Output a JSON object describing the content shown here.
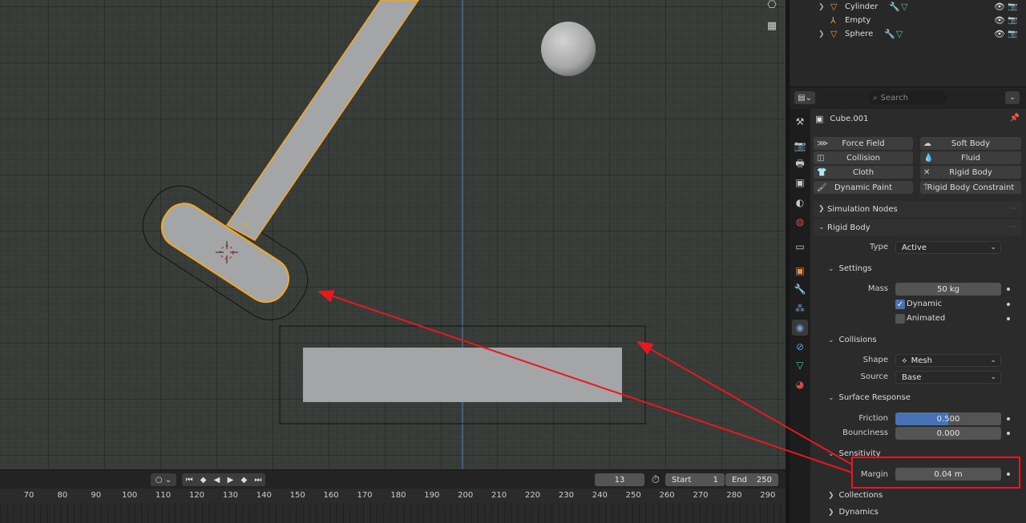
{
  "outliner": {
    "items": [
      {
        "name": "Cylinder",
        "expandable": true
      },
      {
        "name": "Empty",
        "expandable": false
      },
      {
        "name": "Sphere",
        "expandable": true
      }
    ]
  },
  "properties_header": {
    "search_placeholder": "Search"
  },
  "object": {
    "name": "Cube.001"
  },
  "physics_buttons": {
    "force_field": "Force Field",
    "soft_body": "Soft Body",
    "collision": "Collision",
    "fluid": "Fluid",
    "cloth": "Cloth",
    "rigid_body": "Rigid Body",
    "dynamic_paint": "Dynamic Paint",
    "rigid_body_constraint": "Rigid Body Constraint"
  },
  "panels": {
    "simulation_nodes": "Simulation Nodes",
    "rigid_body": "Rigid Body",
    "settings": "Settings",
    "collisions": "Collisions",
    "surface_response": "Surface Response",
    "sensitivity": "Sensitivity",
    "collections": "Collections",
    "dynamics": "Dynamics"
  },
  "rigid_body": {
    "type_label": "Type",
    "type_value": "Active",
    "mass_label": "Mass",
    "mass_value": "50 kg",
    "dynamic_label": "Dynamic",
    "dynamic_checked": true,
    "animated_label": "Animated",
    "animated_checked": false,
    "shape_label": "Shape",
    "shape_value": "Mesh",
    "source_label": "Source",
    "source_value": "Base",
    "friction_label": "Friction",
    "friction_value": "0.500",
    "friction_fraction": 0.5,
    "bounciness_label": "Bounciness",
    "bounciness_value": "0.000",
    "margin_label": "Margin",
    "margin_value": "0.04 m"
  },
  "timeline": {
    "current_frame": "13",
    "start_label": "Start",
    "start_value": "1",
    "end_label": "End",
    "end_value": "250",
    "ruler": [
      "70",
      "80",
      "90",
      "100",
      "110",
      "120",
      "130",
      "140",
      "150",
      "160",
      "170",
      "180",
      "190",
      "200",
      "210",
      "220",
      "230",
      "240",
      "250",
      "260",
      "270",
      "280",
      "290"
    ]
  },
  "colors": {
    "accent_blue": "#4772b3",
    "selection_orange": "#f5a623",
    "annotation_red": "#e8191e",
    "mesh_gray": "#a4a5a7"
  }
}
